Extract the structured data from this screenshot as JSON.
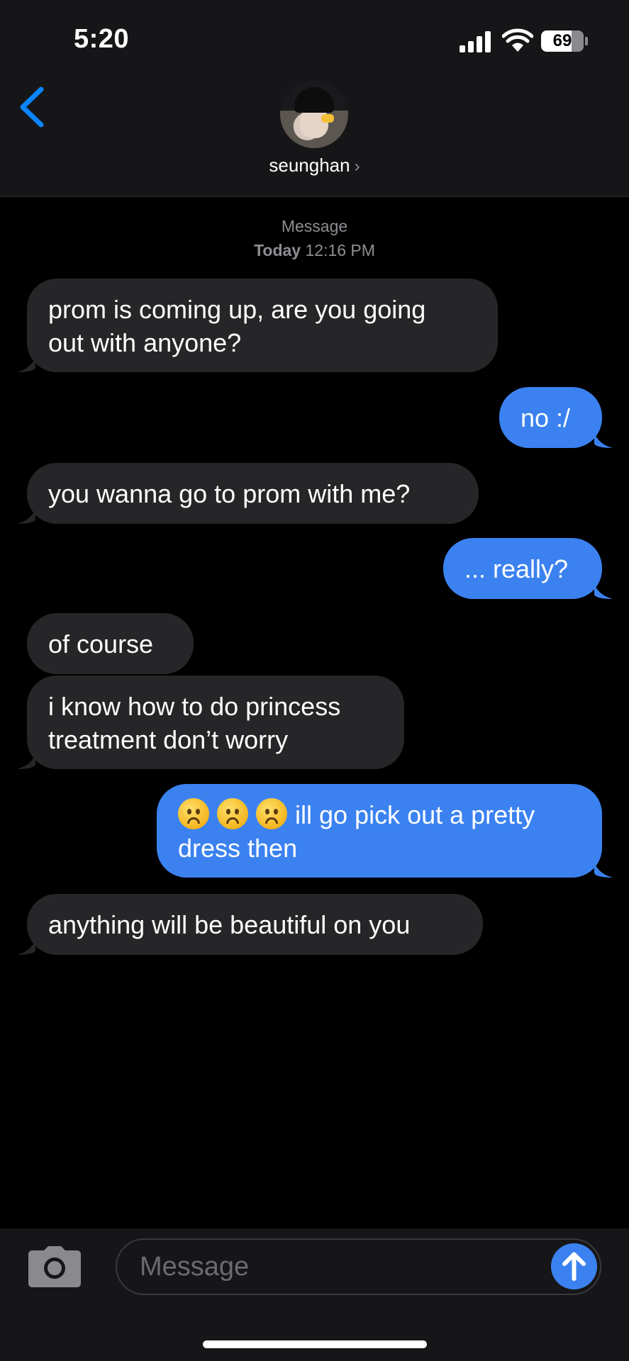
{
  "status_bar": {
    "time": "5:20",
    "battery": "69"
  },
  "header": {
    "contact_name": "seunghan",
    "chevron": "›"
  },
  "thread": {
    "service": "Message",
    "day": "Today",
    "time": "12:16 PM"
  },
  "messages": [
    {
      "direction": "incoming",
      "lines": [
        "prom is coming up, are you going",
        "out with anyone?"
      ]
    },
    {
      "direction": "outgoing",
      "lines": [
        "no :/"
      ]
    },
    {
      "direction": "incoming",
      "lines": [
        "you wanna go to prom with me?"
      ]
    },
    {
      "direction": "outgoing",
      "lines": [
        "... really?"
      ]
    },
    {
      "direction": "incoming",
      "lines": [
        "of course"
      ]
    },
    {
      "direction": "incoming",
      "lines": [
        "i know how to do princess",
        "treatment don’t worry"
      ]
    },
    {
      "direction": "outgoing",
      "emoji": "frowning-face x3",
      "lines": [
        "ill go pick out a pretty",
        "dress then"
      ]
    },
    {
      "direction": "incoming",
      "lines": [
        "anything will be beautiful on you"
      ]
    }
  ],
  "composer": {
    "placeholder": "Message"
  },
  "colors": {
    "outgoing_bubble": "#3b82f0",
    "incoming_bubble": "#262628",
    "accent": "#0a84ff"
  },
  "icons": [
    "back-chevron-icon",
    "camera-icon",
    "send-arrow-icon",
    "signal-icon",
    "wifi-icon",
    "battery-icon"
  ]
}
